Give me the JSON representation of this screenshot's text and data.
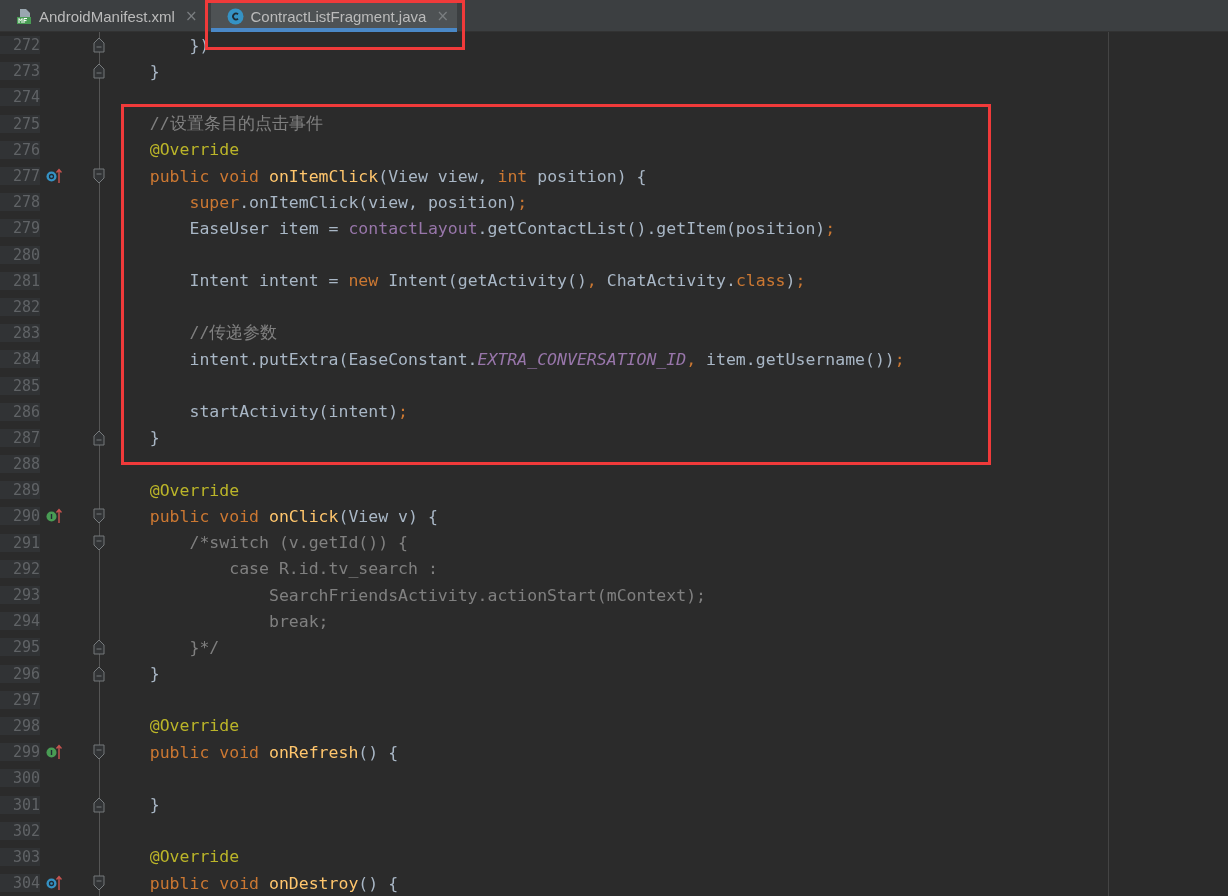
{
  "tabs": [
    {
      "label": "AndroidManifest.xml",
      "kind": "manifest",
      "selected": false,
      "highlighted": false,
      "close": "×"
    },
    {
      "label": "ContractListFragment.java",
      "kind": "class",
      "selected": true,
      "highlighted": true,
      "close": "×"
    }
  ],
  "blocks": [
    {
      "highlighted": false,
      "lines": [
        {
          "number": "272",
          "fold": {
            "kind": "end"
          },
          "tokens": [
            {
              "text": "        })",
              "kind": "plain"
            }
          ]
        },
        {
          "number": "273",
          "fold": {
            "kind": "end"
          },
          "tokens": [
            {
              "text": "    }",
              "kind": "plain"
            }
          ]
        },
        {
          "number": "274"
        }
      ]
    },
    {
      "highlighted": true,
      "lines": [
        {
          "number": "275",
          "tokens": [
            {
              "text": "    //设置条目的点击事件",
              "kind": "comment"
            }
          ]
        },
        {
          "number": "276",
          "tokens": [
            {
              "text": "    @Override",
              "kind": "annotation"
            }
          ]
        },
        {
          "number": "277",
          "marker": {
            "kind": "override"
          },
          "fold": {
            "kind": "start"
          },
          "tokens": [
            {
              "text": "    public void ",
              "kind": "keyword"
            },
            {
              "text": "onItemClick",
              "kind": "method"
            },
            {
              "text": "(View view, ",
              "kind": "plain"
            },
            {
              "text": "int ",
              "kind": "keyword"
            },
            {
              "text": "position) {",
              "kind": "plain"
            }
          ]
        },
        {
          "number": "278",
          "tokens": [
            {
              "text": "        super",
              "kind": "keyword"
            },
            {
              "text": ".onItemClick(view, position)",
              "kind": "plain"
            },
            {
              "text": ";",
              "kind": "keyword"
            }
          ]
        },
        {
          "number": "279",
          "tokens": [
            {
              "text": "        EaseUser item = ",
              "kind": "plain"
            },
            {
              "text": "contactLayout",
              "kind": "field"
            },
            {
              "text": ".getContactList().getItem(position)",
              "kind": "plain"
            },
            {
              "text": ";",
              "kind": "keyword"
            }
          ]
        },
        {
          "number": "280"
        },
        {
          "number": "281",
          "tokens": [
            {
              "text": "        Intent intent = ",
              "kind": "plain"
            },
            {
              "text": "new ",
              "kind": "keyword"
            },
            {
              "text": "Intent(getActivity()",
              "kind": "plain"
            },
            {
              "text": ", ",
              "kind": "keyword"
            },
            {
              "text": "ChatActivity.",
              "kind": "plain"
            },
            {
              "text": "class",
              "kind": "keyword"
            },
            {
              "text": ")",
              "kind": "plain"
            },
            {
              "text": ";",
              "kind": "keyword"
            }
          ]
        },
        {
          "number": "282"
        },
        {
          "number": "283",
          "tokens": [
            {
              "text": "        //传递参数",
              "kind": "comment"
            }
          ]
        },
        {
          "number": "284",
          "tokens": [
            {
              "text": "        intent.putExtra(EaseConstant.",
              "kind": "plain"
            },
            {
              "text": "EXTRA_CONVERSATION_ID",
              "kind": "constant"
            },
            {
              "text": ", ",
              "kind": "keyword"
            },
            {
              "text": "item.getUsername())",
              "kind": "plain"
            },
            {
              "text": ";",
              "kind": "keyword"
            }
          ]
        },
        {
          "number": "285"
        },
        {
          "number": "286",
          "tokens": [
            {
              "text": "        startActivity(intent)",
              "kind": "plain"
            },
            {
              "text": ";",
              "kind": "keyword"
            }
          ]
        },
        {
          "number": "287",
          "fold": {
            "kind": "end"
          },
          "tokens": [
            {
              "text": "    }",
              "kind": "plain"
            }
          ]
        }
      ]
    },
    {
      "highlighted": false,
      "lines": [
        {
          "number": "288"
        },
        {
          "number": "289",
          "tokens": [
            {
              "text": "    @Override",
              "kind": "annotation"
            }
          ]
        },
        {
          "number": "290",
          "marker": {
            "kind": "implement"
          },
          "fold": {
            "kind": "start"
          },
          "tokens": [
            {
              "text": "    public void ",
              "kind": "keyword"
            },
            {
              "text": "onClick",
              "kind": "method"
            },
            {
              "text": "(View v) {",
              "kind": "plain"
            }
          ]
        },
        {
          "number": "291",
          "fold": {
            "kind": "start"
          },
          "tokens": [
            {
              "text": "        /*switch (v.getId()) {",
              "kind": "comment"
            }
          ]
        },
        {
          "number": "292",
          "tokens": [
            {
              "text": "            case R.id.tv_search :",
              "kind": "comment"
            }
          ]
        },
        {
          "number": "293",
          "tokens": [
            {
              "text": "                SearchFriendsActivity.actionStart(mContext);",
              "kind": "comment"
            }
          ]
        },
        {
          "number": "294",
          "tokens": [
            {
              "text": "                break;",
              "kind": "comment"
            }
          ]
        },
        {
          "number": "295",
          "fold": {
            "kind": "end"
          },
          "tokens": [
            {
              "text": "        }*/",
              "kind": "comment"
            }
          ]
        },
        {
          "number": "296",
          "fold": {
            "kind": "end"
          },
          "tokens": [
            {
              "text": "    }",
              "kind": "plain"
            }
          ]
        },
        {
          "number": "297"
        },
        {
          "number": "298",
          "tokens": [
            {
              "text": "    @Override",
              "kind": "annotation"
            }
          ]
        },
        {
          "number": "299",
          "marker": {
            "kind": "implement"
          },
          "fold": {
            "kind": "start"
          },
          "tokens": [
            {
              "text": "    public void ",
              "kind": "keyword"
            },
            {
              "text": "onRefresh",
              "kind": "method"
            },
            {
              "text": "() {",
              "kind": "plain"
            }
          ]
        },
        {
          "number": "300"
        },
        {
          "number": "301",
          "fold": {
            "kind": "end"
          },
          "tokens": [
            {
              "text": "    }",
              "kind": "plain"
            }
          ]
        },
        {
          "number": "302"
        },
        {
          "number": "303",
          "tokens": [
            {
              "text": "    @Override",
              "kind": "annotation"
            }
          ]
        },
        {
          "number": "304",
          "marker": {
            "kind": "override"
          },
          "fold": {
            "kind": "start"
          },
          "tokens": [
            {
              "text": "    public void ",
              "kind": "keyword"
            },
            {
              "text": "onDestroy",
              "kind": "method"
            },
            {
              "text": "() {",
              "kind": "plain"
            }
          ]
        }
      ]
    }
  ]
}
